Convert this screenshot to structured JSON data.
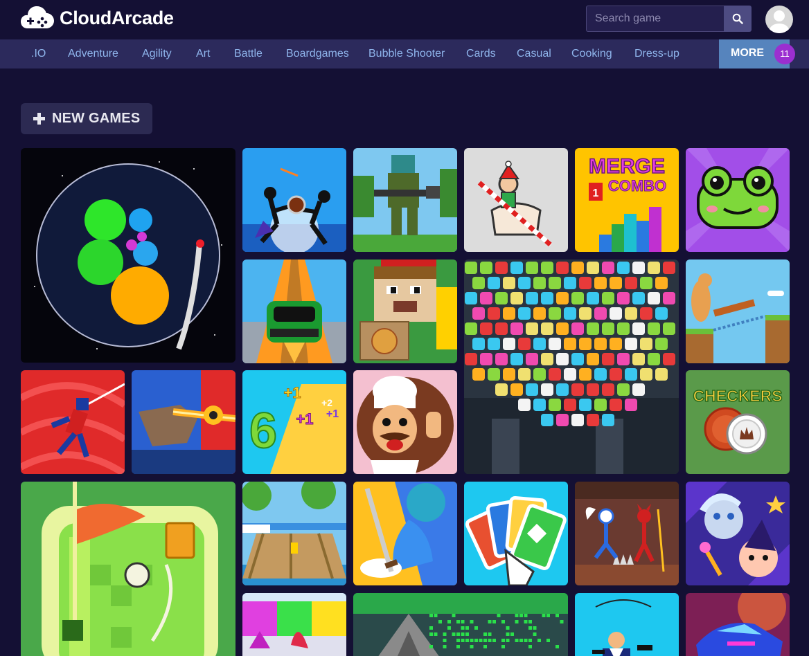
{
  "header": {
    "logo_text": "CloudArcade",
    "search_placeholder": "Search game"
  },
  "nav": {
    "items": [
      ".IO",
      "Adventure",
      "Agility",
      "Art",
      "Battle",
      "Boardgames",
      "Bubble Shooter",
      "Cards",
      "Casual",
      "Cooking",
      "Dress-up"
    ],
    "more_label": "MORE",
    "more_count": "11"
  },
  "section": {
    "new_games_label": "NEW GAMES"
  },
  "tiles": {
    "merge_combo_line1": "MERGE",
    "merge_combo_line2": "COMBO",
    "checkers_title": "CHECKERS"
  },
  "colors": {
    "background": "#141034",
    "nav_background": "#2c2a5c",
    "nav_text": "#8fb5ec",
    "more_button": "#5684bd",
    "badge": "#9b2fd0"
  }
}
